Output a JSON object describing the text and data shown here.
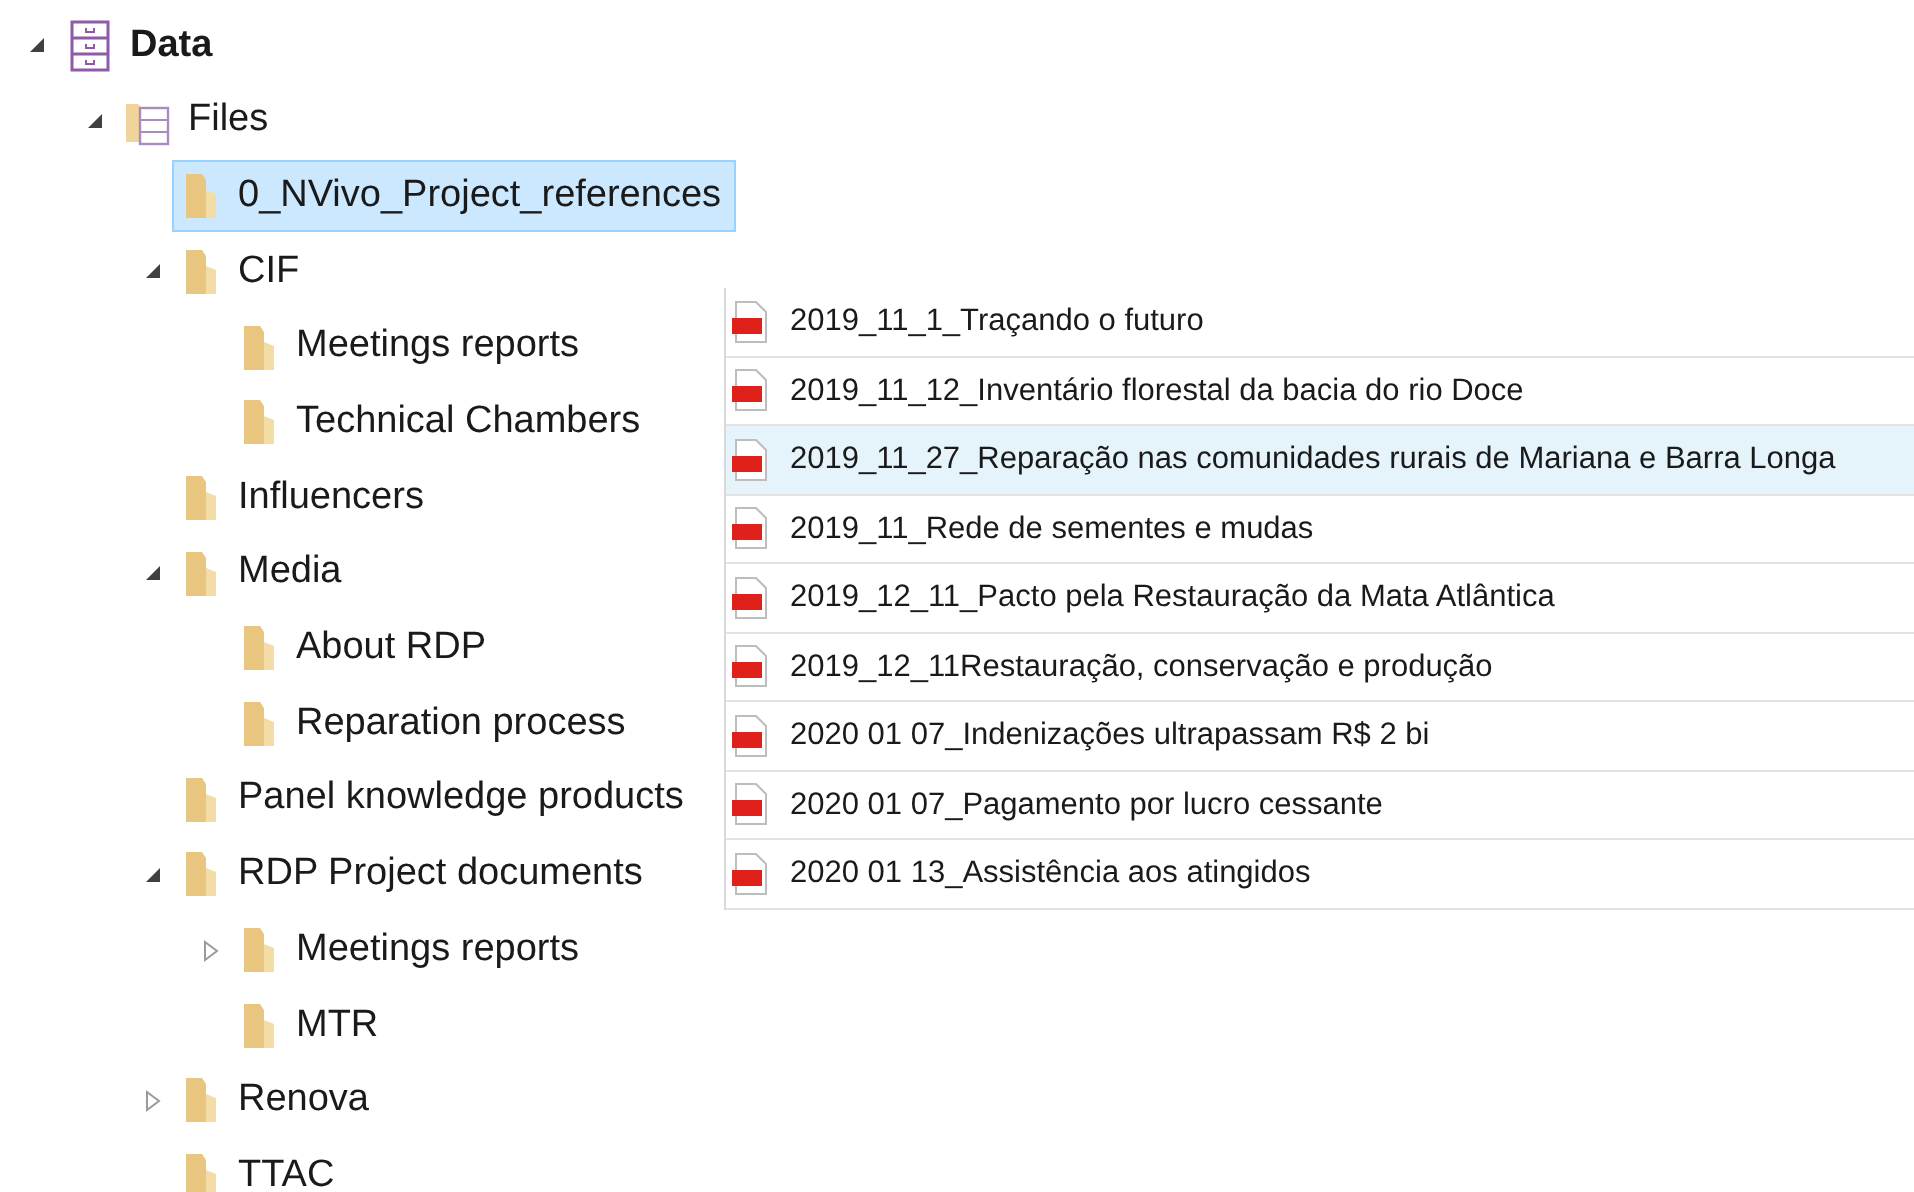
{
  "tree": [
    {
      "label": "Data",
      "kind": "root",
      "expanded": true,
      "selected": false,
      "children": [
        {
          "label": "Files",
          "kind": "files",
          "expanded": true,
          "selected": false,
          "children": [
            {
              "label": "0_NVivo_Project_references",
              "kind": "folder",
              "selected": true
            },
            {
              "label": "CIF",
              "kind": "folder",
              "expanded": true,
              "selected": false,
              "children": [
                {
                  "label": "Meetings reports",
                  "kind": "folder",
                  "selected": false
                },
                {
                  "label": "Technical Chambers",
                  "kind": "folder",
                  "selected": false
                }
              ]
            },
            {
              "label": "Influencers",
              "kind": "folder",
              "selected": false
            },
            {
              "label": "Media",
              "kind": "folder",
              "expanded": true,
              "selected": false,
              "children": [
                {
                  "label": "About RDP",
                  "kind": "folder",
                  "selected": false
                },
                {
                  "label": "Reparation process",
                  "kind": "folder",
                  "selected": false
                }
              ]
            },
            {
              "label": "Panel knowledge products",
              "kind": "folder",
              "selected": false
            },
            {
              "label": "RDP Project documents",
              "kind": "folder",
              "expanded": true,
              "selected": false,
              "children": [
                {
                  "label": "Meetings reports",
                  "kind": "folder",
                  "expanded": false,
                  "selected": false
                },
                {
                  "label": "MTR",
                  "kind": "folder",
                  "selected": false
                }
              ]
            },
            {
              "label": "Renova",
              "kind": "folder",
              "expanded": false,
              "selected": false
            },
            {
              "label": "TTAC",
              "kind": "folder",
              "selected": false
            }
          ]
        }
      ]
    }
  ],
  "files": [
    {
      "name": "2019_11_1_Traçando o futuro",
      "selected": false
    },
    {
      "name": "2019_11_12_Inventário florestal da bacia do rio Doce",
      "selected": false
    },
    {
      "name": "2019_11_27_Reparação nas comunidades rurais de Mariana e Barra Longa",
      "selected": true
    },
    {
      "name": "2019_11_Rede de sementes e mudas",
      "selected": false
    },
    {
      "name": "2019_12_11_Pacto pela Restauração da Mata Atlântica",
      "selected": false
    },
    {
      "name": "2019_12_11Restauração, conservação e produção",
      "selected": false
    },
    {
      "name": "2020 01 07_Indenizações ultrapassam R$ 2 bi",
      "selected": false
    },
    {
      "name": "2020 01 07_Pagamento por lucro cessante",
      "selected": false
    },
    {
      "name": "2020 01 13_Assistência aos atingidos",
      "selected": false
    }
  ]
}
